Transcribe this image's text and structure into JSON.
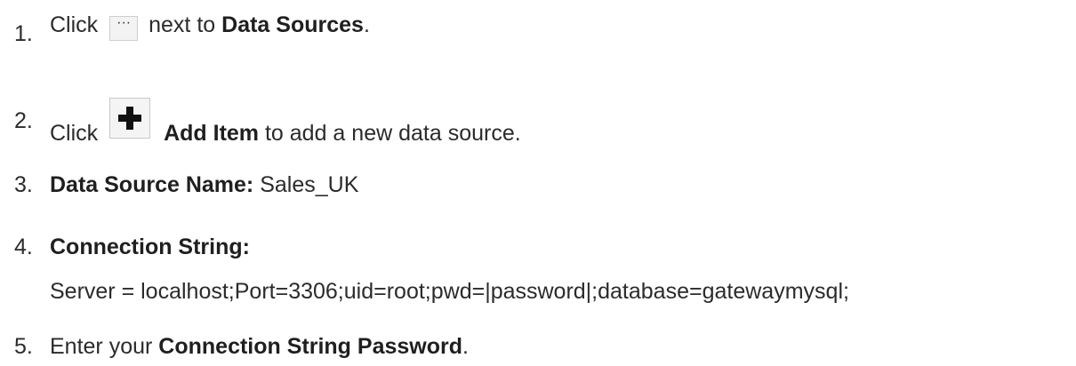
{
  "steps": [
    {
      "num": "1.",
      "pre": "Click",
      "post": "next to",
      "bold": "Data Sources",
      "end": "."
    },
    {
      "num": "2.",
      "pre": "Click",
      "bold": "Add Item",
      "post": "to add a new data source."
    },
    {
      "num": "3.",
      "bold": "Data Source Name:",
      "post": "Sales_UK"
    },
    {
      "num": "4.",
      "bold": "Connection String:",
      "detail": "Server = localhost;Port=3306;uid=root;pwd=|password|;database=gatewaymysql;"
    },
    {
      "num": "5.",
      "pre": "Enter your",
      "bold": "Connection String Password",
      "end": "."
    }
  ],
  "icons": {
    "ellipsis": "ellipsis-icon",
    "add": "plus-icon"
  }
}
